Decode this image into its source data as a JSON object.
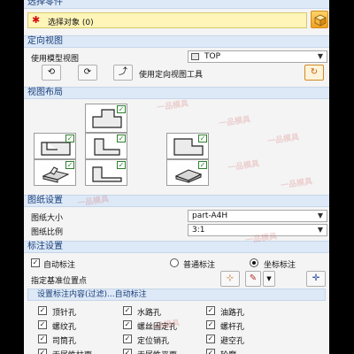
{
  "select_part": {
    "header": "选择零件",
    "select_label": "选择对象 (0)"
  },
  "orient_view": {
    "header": "定向视图",
    "model_view_label": "使用模型视图",
    "model_view_value": "TOP",
    "tool_label": "使用定向视图工具"
  },
  "view_layout": {
    "header": "视图布局"
  },
  "sheet": {
    "header": "图纸设置",
    "size_label": "图纸大小",
    "size_value": "part-A4H",
    "scale_label": "图纸比例",
    "scale_value": "3:1"
  },
  "annotation": {
    "header": "标注设置",
    "auto_label": "自动标注",
    "auto_checked": true,
    "normal_label": "普通标注",
    "coord_label": "坐标标注",
    "selected_mode": "coord",
    "base_point_label": "指定基准位置点",
    "content_header": "设置标注内容(过滤)...自动标注",
    "items": [
      {
        "label": "顶针孔",
        "checked": true
      },
      {
        "label": "水路孔",
        "checked": true
      },
      {
        "label": "油路孔",
        "checked": true
      },
      {
        "label": "螺纹孔",
        "checked": true
      },
      {
        "label": "螺丝固定孔",
        "checked": true
      },
      {
        "label": "螺杆孔",
        "checked": true
      },
      {
        "label": "司筒孔",
        "checked": true
      },
      {
        "label": "定位销孔",
        "checked": true
      },
      {
        "label": "避空孔",
        "checked": true
      },
      {
        "label": "无属性柱面",
        "checked": true
      },
      {
        "label": "无属性平面",
        "checked": true
      },
      {
        "label": "轮廓",
        "checked": true
      }
    ]
  },
  "watermark": "一品模具"
}
